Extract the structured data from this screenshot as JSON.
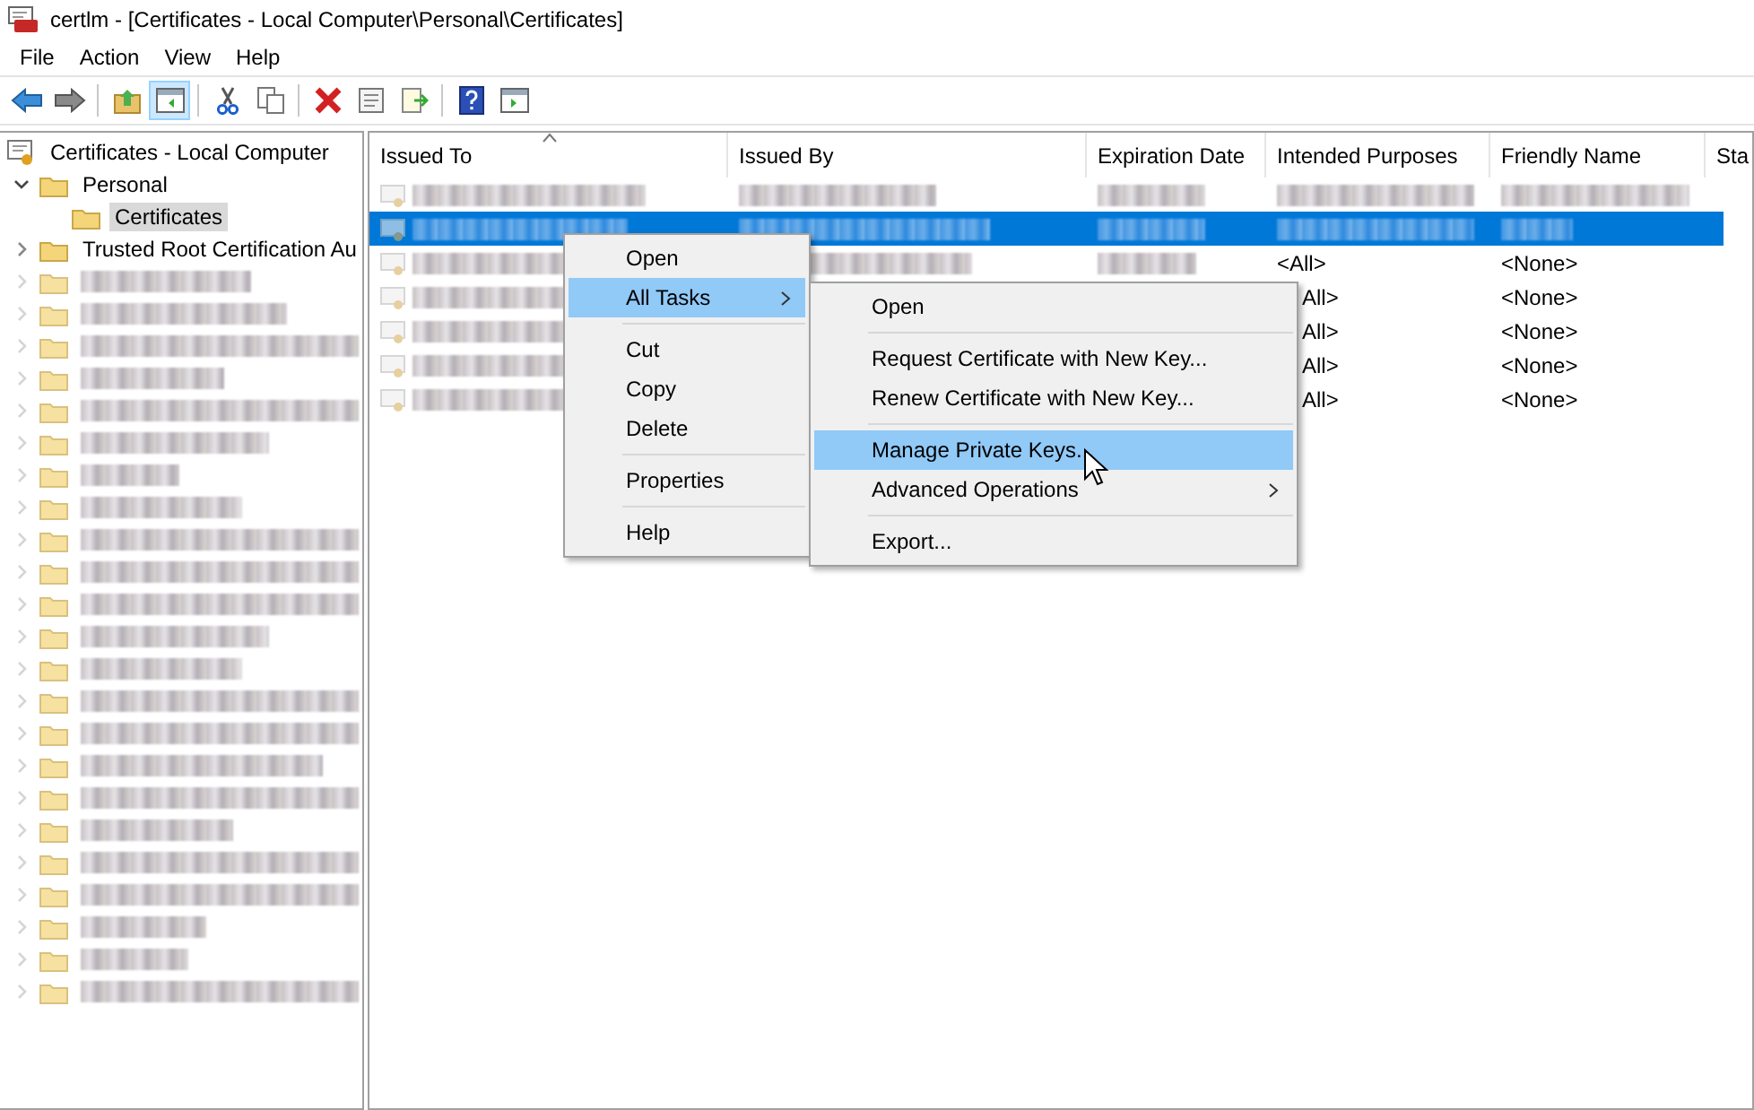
{
  "window": {
    "title": "certlm - [Certificates - Local Computer\\Personal\\Certificates]"
  },
  "menu": [
    "File",
    "Action",
    "View",
    "Help"
  ],
  "toolbar": [
    {
      "kind": "back"
    },
    {
      "kind": "forward"
    },
    {
      "kind": "sep"
    },
    {
      "kind": "up"
    },
    {
      "kind": "tree",
      "selected": true
    },
    {
      "kind": "sep"
    },
    {
      "kind": "cut"
    },
    {
      "kind": "copy"
    },
    {
      "kind": "sep"
    },
    {
      "kind": "delete"
    },
    {
      "kind": "properties"
    },
    {
      "kind": "export"
    },
    {
      "kind": "sep"
    },
    {
      "kind": "help"
    },
    {
      "kind": "actionpane"
    }
  ],
  "tree": {
    "label": "Certificates - Local Computer",
    "children": [
      {
        "label": "Personal",
        "expanded": true,
        "selected": false,
        "children": [
          {
            "label": "Certificates",
            "selected": true
          }
        ]
      },
      {
        "label": "Trusted Root Certification Au",
        "expanded": false,
        "selected": false
      },
      {
        "redacted": true
      },
      {
        "redacted": true
      },
      {
        "redacted": true
      },
      {
        "redacted": true
      },
      {
        "redacted": true
      },
      {
        "redacted": true
      },
      {
        "redacted": true
      },
      {
        "redacted": true
      },
      {
        "redacted": true
      },
      {
        "redacted": true
      },
      {
        "redacted": true
      },
      {
        "redacted": true
      },
      {
        "redacted": true
      },
      {
        "redacted": true
      },
      {
        "redacted": true
      },
      {
        "redacted": true
      },
      {
        "redacted": true
      },
      {
        "redacted": true
      },
      {
        "redacted": true
      },
      {
        "redacted": true
      },
      {
        "redacted": true
      },
      {
        "redacted": true
      },
      {
        "redacted": true
      }
    ]
  },
  "table": {
    "columns": [
      {
        "label": "Issued To",
        "sorted": true
      },
      {
        "label": "Issued By",
        "sorted": false
      },
      {
        "label": "Expiration Date",
        "sorted": false
      },
      {
        "label": "Intended Purposes",
        "sorted": false
      },
      {
        "label": "Friendly Name",
        "sorted": false
      },
      {
        "label": "Sta",
        "sorted": false
      }
    ],
    "rows": [
      {
        "selected": false,
        "cells": [
          {
            "redacted": true
          },
          {
            "redacted": true
          },
          {
            "redacted": true
          },
          {
            "redacted": true
          },
          {
            "redacted": true
          }
        ]
      },
      {
        "selected": true,
        "cells": [
          {
            "redacted": true
          },
          {
            "redacted": true
          },
          {
            "redacted": true
          },
          {
            "redacted": true
          },
          {
            "redacted": true
          }
        ]
      },
      {
        "selected": false,
        "cells": [
          {
            "redacted": true
          },
          {
            "redacted": true
          },
          {
            "redacted": true
          },
          {
            "text": "<All>"
          },
          {
            "text": "<None>"
          }
        ]
      },
      {
        "selected": false,
        "kind": "partly_covered",
        "cells": [
          {
            "redacted": true
          },
          {
            "text": "All>"
          },
          {
            "text": "<None>"
          }
        ]
      },
      {
        "selected": false,
        "kind": "partly_covered",
        "cells": [
          {
            "redacted": true
          },
          {
            "text": "All>"
          },
          {
            "text": "<None>"
          }
        ]
      },
      {
        "selected": false,
        "kind": "partly_covered",
        "cells": [
          {
            "redacted": true
          },
          {
            "text": "All>"
          },
          {
            "text": "<None>"
          }
        ]
      },
      {
        "selected": false,
        "kind": "partly_covered",
        "cells": [
          {
            "redacted": true
          },
          {
            "text": "All>"
          },
          {
            "text": "<None>"
          }
        ]
      }
    ]
  },
  "context_menu": {
    "items": [
      {
        "kind": "item",
        "label": "Open",
        "selected": false
      },
      {
        "kind": "submenu",
        "label": "All Tasks",
        "selected": true
      },
      {
        "kind": "sep"
      },
      {
        "kind": "item",
        "label": "Cut",
        "selected": false
      },
      {
        "kind": "item",
        "label": "Copy",
        "selected": false
      },
      {
        "kind": "item",
        "label": "Delete",
        "selected": false
      },
      {
        "kind": "sep"
      },
      {
        "kind": "item",
        "label": "Properties",
        "selected": false
      },
      {
        "kind": "sep"
      },
      {
        "kind": "item",
        "label": "Help",
        "selected": false
      }
    ]
  },
  "submenu": {
    "items": [
      {
        "kind": "item",
        "label": "Open",
        "selected": false
      },
      {
        "kind": "sep"
      },
      {
        "kind": "item",
        "label": "Request Certificate with New Key...",
        "selected": false
      },
      {
        "kind": "item",
        "label": "Renew Certificate with New Key...",
        "selected": false
      },
      {
        "kind": "sep"
      },
      {
        "kind": "item",
        "label": "Manage Private Keys...",
        "selected": true
      },
      {
        "kind": "submenu",
        "label": "Advanced Operations",
        "selected": false
      },
      {
        "kind": "sep"
      },
      {
        "kind": "item",
        "label": "Export...",
        "selected": false
      }
    ]
  }
}
